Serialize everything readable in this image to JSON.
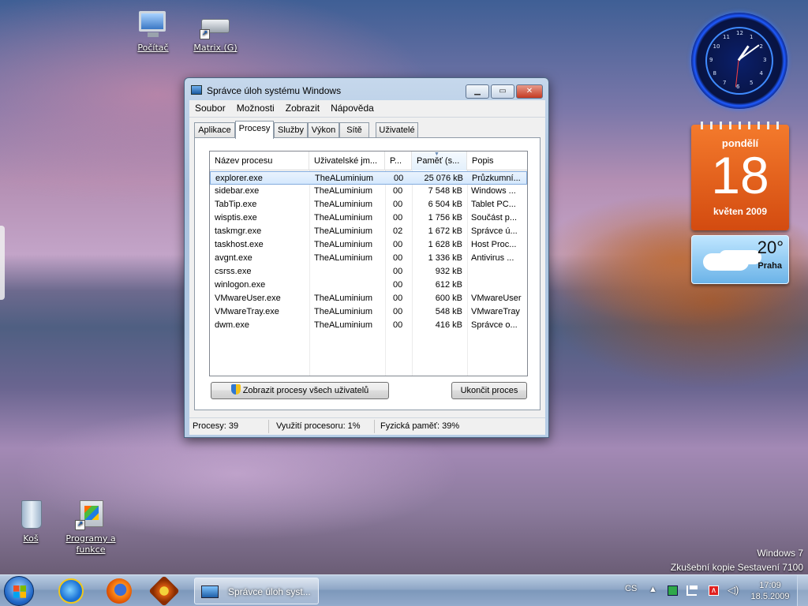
{
  "desktop": {
    "icons": [
      {
        "label": "Počítač"
      },
      {
        "label": "Matrix (G)"
      },
      {
        "label": "Koš"
      },
      {
        "label": "Programy a funkce"
      }
    ],
    "watermark": {
      "line1": "Windows 7",
      "line2": "Zkušební kopie Sestavení 7100"
    }
  },
  "gadgets": {
    "clock": {
      "hour": 1,
      "minute": 9,
      "second": 31,
      "numbers": [
        "12",
        "1",
        "2",
        "3",
        "4",
        "5",
        "6",
        "7",
        "8",
        "9",
        "10",
        "11"
      ]
    },
    "calendar": {
      "weekday": "pondělí",
      "day": "18",
      "month_year": "květen 2009"
    },
    "weather": {
      "temperature": "20°",
      "city": "Praha"
    }
  },
  "task_manager": {
    "title": "Správce úloh systému Windows",
    "menu": [
      "Soubor",
      "Možnosti",
      "Zobrazit",
      "Nápověda"
    ],
    "tabs": [
      "Aplikace",
      "Procesy",
      "Služby",
      "Výkon",
      "Sítě",
      "Uživatelé"
    ],
    "active_tab": "Procesy",
    "columns": [
      "Název procesu",
      "Uživatelské jm...",
      "P...",
      "Paměť (s...",
      "Popis"
    ],
    "sorted_column": "Paměť (s...",
    "rows": [
      {
        "name": "explorer.exe",
        "user": "TheALuminium",
        "cpu": "00",
        "memory": "25 076 kB",
        "desc": "Průzkumní..."
      },
      {
        "name": "sidebar.exe",
        "user": "TheALuminium",
        "cpu": "00",
        "memory": "7 548 kB",
        "desc": "Windows ..."
      },
      {
        "name": "TabTip.exe",
        "user": "TheALuminium",
        "cpu": "00",
        "memory": "6 504 kB",
        "desc": "Tablet PC..."
      },
      {
        "name": "wisptis.exe",
        "user": "TheALuminium",
        "cpu": "00",
        "memory": "1 756 kB",
        "desc": "Součást p..."
      },
      {
        "name": "taskmgr.exe",
        "user": "TheALuminium",
        "cpu": "02",
        "memory": "1 672 kB",
        "desc": "Správce ú..."
      },
      {
        "name": "taskhost.exe",
        "user": "TheALuminium",
        "cpu": "00",
        "memory": "1 628 kB",
        "desc": "Host Proc..."
      },
      {
        "name": "avgnt.exe",
        "user": "TheALuminium",
        "cpu": "00",
        "memory": "1 336 kB",
        "desc": "Antivirus ..."
      },
      {
        "name": "csrss.exe",
        "user": "",
        "cpu": "00",
        "memory": "932 kB",
        "desc": ""
      },
      {
        "name": "winlogon.exe",
        "user": "",
        "cpu": "00",
        "memory": "612 kB",
        "desc": ""
      },
      {
        "name": "VMwareUser.exe",
        "user": "TheALuminium",
        "cpu": "00",
        "memory": "600 kB",
        "desc": "VMwareUser"
      },
      {
        "name": "VMwareTray.exe",
        "user": "TheALuminium",
        "cpu": "00",
        "memory": "548 kB",
        "desc": "VMwareTray"
      },
      {
        "name": "dwm.exe",
        "user": "TheALuminium",
        "cpu": "00",
        "memory": "416 kB",
        "desc": "Správce o..."
      }
    ],
    "selected_row": "explorer.exe",
    "show_all_button": "Zobrazit procesy všech uživatelů",
    "end_process_button": "Ukončit proces",
    "status": {
      "processes": "Procesy: 39",
      "cpu": "Využití procesoru: 1%",
      "memory": "Fyzická paměť: 39%"
    }
  },
  "taskbar": {
    "pinned": [
      "internet-explorer-icon",
      "firefox-icon",
      "gimp-icon"
    ],
    "task_label": "Správce úloh syst...",
    "language": "CS",
    "time": "17:09",
    "date": "18.5.2009"
  }
}
